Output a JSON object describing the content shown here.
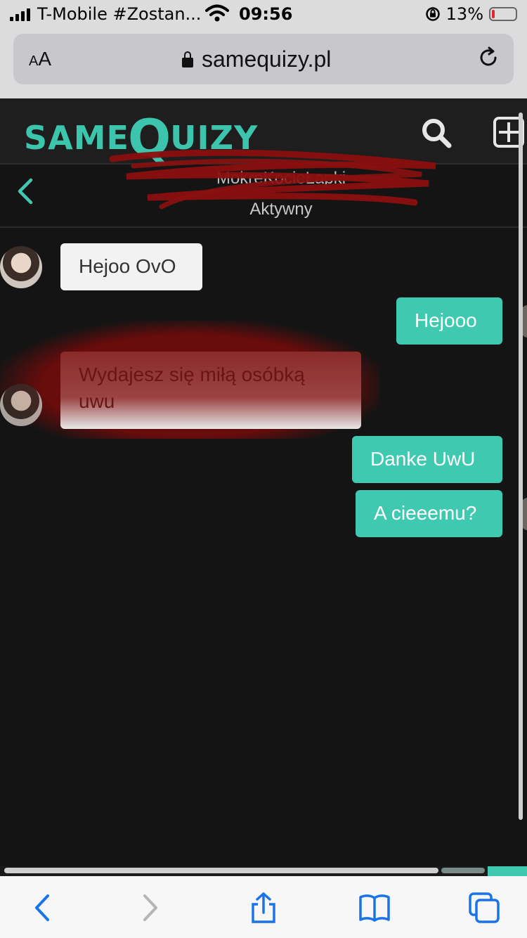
{
  "status_bar": {
    "carrier": "T-Mobile #Zostan...",
    "time": "09:56",
    "battery_percent": "13%",
    "battery_level": 0.13
  },
  "browser": {
    "text_size_label_small": "A",
    "text_size_label_large": "A",
    "url_host": "samequizy.pl"
  },
  "site": {
    "logo_left": "SAME",
    "logo_q": "Q",
    "logo_right": "UIZY"
  },
  "chat": {
    "contact_name": "MokreKocieŁapki",
    "contact_status": "Aktywny",
    "messages": [
      {
        "direction": "in",
        "text": "Hejoo OvO"
      },
      {
        "direction": "out",
        "text": "Hejooo"
      },
      {
        "direction": "in",
        "text": "Wydajesz się miłą osóbką uwu"
      },
      {
        "direction": "out",
        "text": "Danke UwU"
      },
      {
        "direction": "out",
        "text": "A cieeemu?"
      }
    ]
  },
  "colors": {
    "accent": "#40c9b1",
    "page_background": "#141414",
    "header_background": "#1e1e1e",
    "incoming_bubble": "#f2f2f2",
    "scribble": "#8b0f0f"
  },
  "icons": {
    "back": "chevron-left-icon",
    "search": "search-icon",
    "add": "plus-square-icon",
    "lock": "lock-icon",
    "reload": "reload-icon",
    "nav_back": "arrow-left-icon",
    "nav_forward": "arrow-right-icon",
    "share": "share-icon",
    "bookmarks": "book-icon",
    "tabs": "tabs-icon"
  }
}
